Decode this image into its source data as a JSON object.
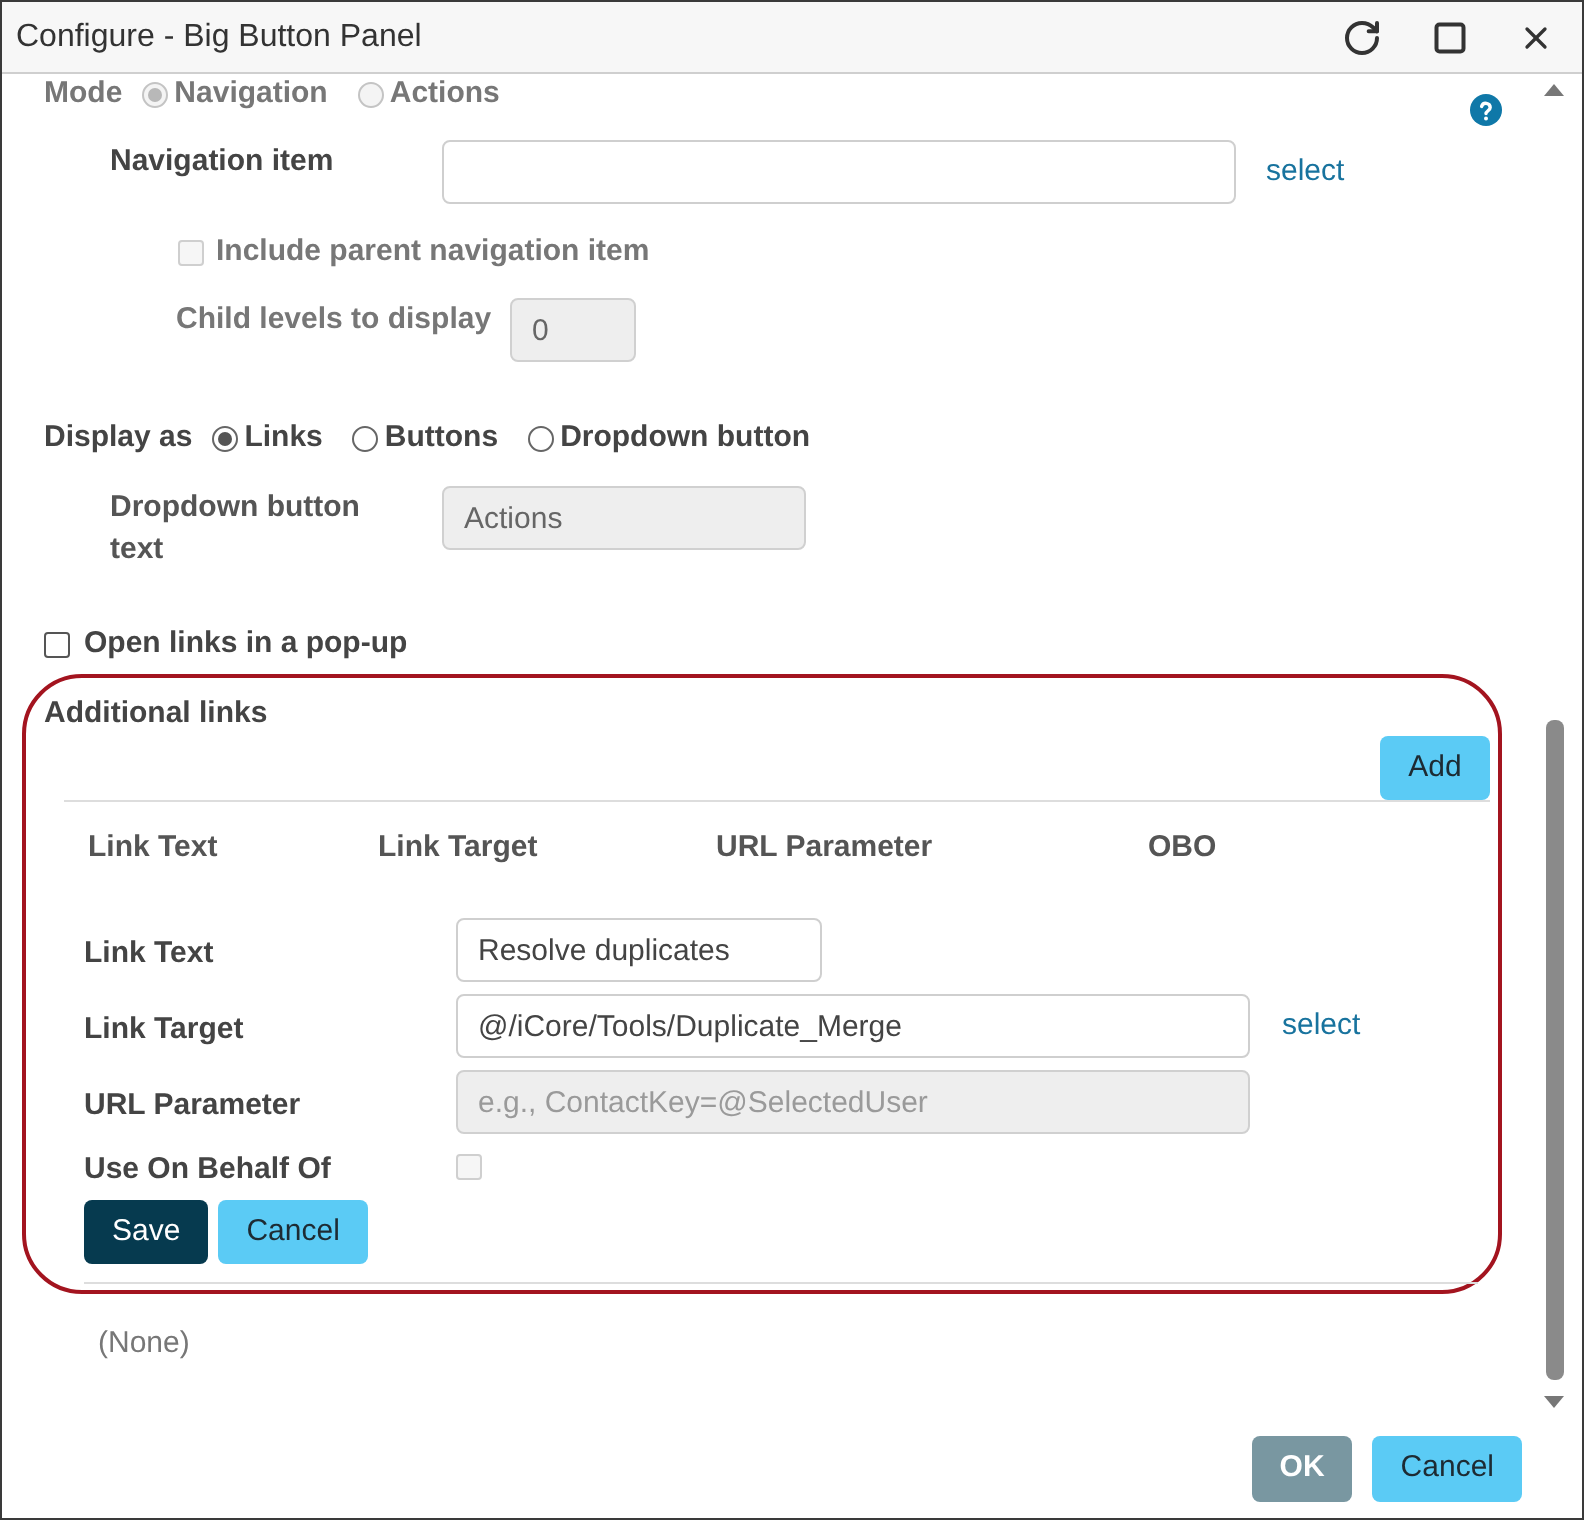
{
  "window": {
    "title": "Configure - Big Button Panel"
  },
  "mode": {
    "label": "Mode",
    "disabled": true,
    "options": [
      {
        "label": "Navigation",
        "selected": true
      },
      {
        "label": "Actions",
        "selected": false
      }
    ]
  },
  "navigation_item": {
    "label": "Navigation item",
    "link": "select"
  },
  "include_parent": {
    "label": "Include parent navigation item",
    "checked": false,
    "disabled": true
  },
  "child_levels": {
    "label": "Child levels to display",
    "value": "0",
    "disabled": true
  },
  "display_as": {
    "label": "Display as",
    "options": [
      {
        "label": "Links",
        "selected": true
      },
      {
        "label": "Buttons",
        "selected": false
      },
      {
        "label": "Dropdown button",
        "selected": false
      }
    ]
  },
  "dropdown_button_text": {
    "label": "Dropdown button text",
    "value": "Actions",
    "disabled": true
  },
  "open_in_popup": {
    "label": "Open links in a pop-up",
    "checked": false
  },
  "additional_links": {
    "title": "Additional links",
    "add_button": "Add",
    "columns": [
      "Link Text",
      "Link Target",
      "URL Parameter",
      "OBO"
    ],
    "form": {
      "fields": [
        {
          "kind": "text",
          "label": "Link Text",
          "value": "Resolve duplicates",
          "disabled": false
        },
        {
          "kind": "text",
          "label": "Link Target",
          "value": "@/iCore/Tools/Duplicate_Merge",
          "disabled": false,
          "link": "select"
        },
        {
          "kind": "text",
          "label": "URL Parameter",
          "placeholder": "e.g., ContactKey=@SelectedUser",
          "disabled": true
        },
        {
          "kind": "checkbox",
          "label": "Use On Behalf Of",
          "checked": false,
          "disabled": true
        }
      ],
      "buttons": [
        {
          "label": "Save",
          "kind": "primary"
        },
        {
          "label": "Cancel",
          "kind": "secondary"
        }
      ]
    },
    "empty_text": "(None)"
  },
  "buttons": [
    {
      "label": "OK",
      "kind": "muted"
    },
    {
      "label": "Cancel",
      "kind": "secondary"
    }
  ]
}
